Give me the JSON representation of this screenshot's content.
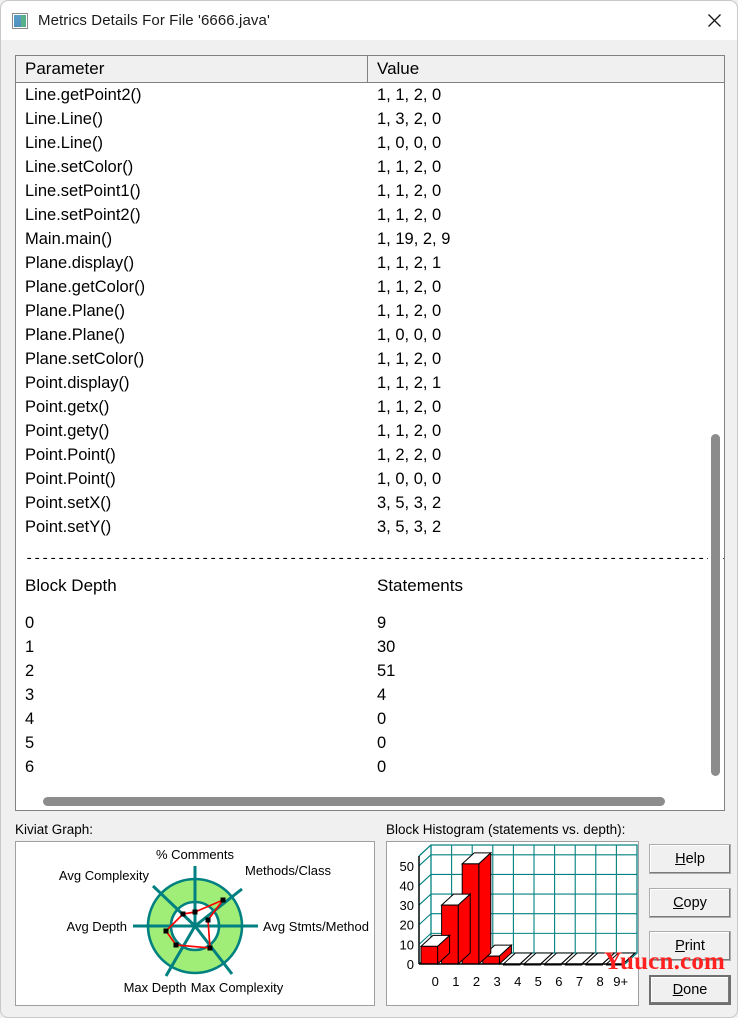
{
  "window": {
    "title": "Metrics Details For File '6666.java'",
    "icon": "metrics-window-icon",
    "close_icon": "close-icon"
  },
  "table": {
    "headers": [
      "Parameter",
      "Value"
    ],
    "rows": [
      [
        "Line.getPoint2()",
        "1, 1, 2, 0"
      ],
      [
        "Line.Line()",
        "1, 3, 2, 0"
      ],
      [
        "Line.Line()",
        "1, 0, 0, 0"
      ],
      [
        "Line.setColor()",
        "1, 1, 2, 0"
      ],
      [
        "Line.setPoint1()",
        "1, 1, 2, 0"
      ],
      [
        "Line.setPoint2()",
        "1, 1, 2, 0"
      ],
      [
        "Main.main()",
        "1, 19, 2, 9"
      ],
      [
        "Plane.display()",
        "1, 1, 2, 1"
      ],
      [
        "Plane.getColor()",
        "1, 1, 2, 0"
      ],
      [
        "Plane.Plane()",
        "1, 1, 2, 0"
      ],
      [
        "Plane.Plane()",
        "1, 0, 0, 0"
      ],
      [
        "Plane.setColor()",
        "1, 1, 2, 0"
      ],
      [
        "Point.display()",
        "1, 1, 2, 1"
      ],
      [
        "Point.getx()",
        "1, 1, 2, 0"
      ],
      [
        "Point.gety()",
        "1, 1, 2, 0"
      ],
      [
        "Point.Point()",
        "1, 2, 2, 0"
      ],
      [
        "Point.Point()",
        "1, 0, 0, 0"
      ],
      [
        "Point.setX()",
        "3, 5, 3, 2"
      ],
      [
        "Point.setY()",
        "3, 5, 3, 2"
      ]
    ],
    "separator": "---------------------------------------------",
    "section_headers": [
      "Block Depth",
      "Statements"
    ],
    "block_rows": [
      [
        "0",
        "9"
      ],
      [
        "1",
        "30"
      ],
      [
        "2",
        "51"
      ],
      [
        "3",
        "4"
      ],
      [
        "4",
        "0"
      ],
      [
        "5",
        "0"
      ],
      [
        "6",
        "0"
      ]
    ]
  },
  "kiviat": {
    "label": "Kiviat Graph:",
    "axes": [
      "% Comments",
      "Methods/Class",
      "Avg Stmts/Method",
      "Max Complexity",
      "Max Depth",
      "Avg Depth",
      "Avg Complexity"
    ],
    "ring_color": "#a0ee78",
    "spoke_color": "#008080",
    "trace_color": "#ff0000"
  },
  "histogram": {
    "label": "Block Histogram (statements vs. depth):"
  },
  "chart_data": {
    "type": "bar",
    "title": "Block Histogram (statements vs. depth)",
    "xlabel": "depth",
    "ylabel": "statements",
    "categories": [
      "0",
      "1",
      "2",
      "3",
      "4",
      "5",
      "6",
      "7",
      "8",
      "9+"
    ],
    "values": [
      9,
      30,
      51,
      4,
      0,
      0,
      0,
      0,
      0,
      0
    ],
    "yticks": [
      0,
      10,
      20,
      30,
      40,
      50
    ],
    "ylim": [
      0,
      55
    ],
    "grid": true,
    "legend": "none",
    "bar_color": "#ff0000",
    "grid_color": "#008080"
  },
  "buttons": [
    {
      "id": "help",
      "mnemonic": "H",
      "rest": "elp"
    },
    {
      "id": "copy",
      "mnemonic": "C",
      "rest": "opy"
    },
    {
      "id": "print",
      "mnemonic": "P",
      "rest": "rint"
    },
    {
      "id": "done",
      "mnemonic": "D",
      "rest": "one"
    }
  ],
  "watermark": "Yuucn.com"
}
